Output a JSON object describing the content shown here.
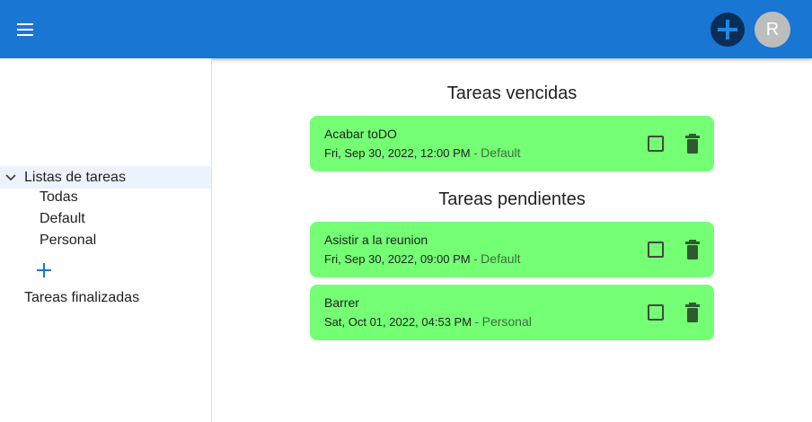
{
  "appbar": {
    "menu_icon": "menu-icon",
    "add_icon": "plus-icon",
    "avatar_initial": "R",
    "color": "#1976d2"
  },
  "sidebar": {
    "tree_root_label": "Listas de tareas",
    "lists": [
      {
        "label": "Todas"
      },
      {
        "label": "Default"
      },
      {
        "label": "Personal"
      }
    ],
    "add_list_icon": "plus-icon",
    "finished_label": "Tareas finalizadas"
  },
  "main": {
    "overdue_title": "Tareas vencidas",
    "pending_title": "Tareas pendientes",
    "overdue_tasks": [
      {
        "name": "Acabar toDO",
        "date": "Fri, Sep 30, 2022, 12:00 PM",
        "list": "Default"
      }
    ],
    "pending_tasks": [
      {
        "name": "Asistir a la reunion",
        "date": "Fri, Sep 30, 2022, 09:00 PM",
        "list": "Default"
      },
      {
        "name": "Barrer",
        "date": "Sat, Oct 01, 2022, 04:53 PM",
        "list": "Personal"
      }
    ],
    "separator": " - ",
    "task_color": "#74ff74"
  }
}
